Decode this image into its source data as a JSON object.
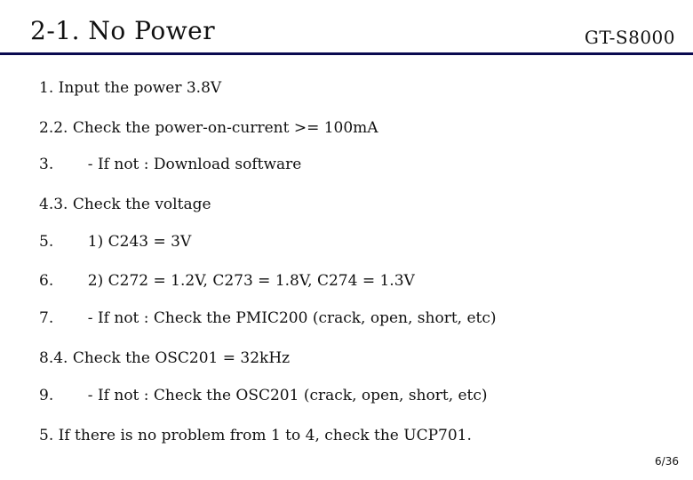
{
  "header": {
    "title": "2-1. No Power",
    "model": "GT-S8000"
  },
  "lines": [
    {
      "num": "",
      "text": "1. Input the power 3.8V"
    },
    {
      "num": "",
      "text": "2.2. Check the power-on-current >= 100mA"
    },
    {
      "num": "3.",
      "text": "  - If not : Download software"
    },
    {
      "num": "",
      "text": "4.3. Check the voltage"
    },
    {
      "num": "5.",
      "text": "  1) C243 = 3V"
    },
    {
      "num": "6.",
      "text": "  2) C272 = 1.2V, C273 = 1.8V, C274 = 1.3V"
    },
    {
      "num": "7.",
      "text": "  - If not : Check the PMIC200 (crack, open, short, etc)"
    },
    {
      "num": "",
      "text": "8.4. Check the OSC201 = 32kHz"
    },
    {
      "num": "9.",
      "text": "  - If not : Check the OSC201 (crack, open, short, etc)"
    },
    {
      "num": "",
      "text": "5. If there is no problem from 1 to 4, check the UCP701."
    }
  ],
  "footer": {
    "page": "6/36"
  }
}
